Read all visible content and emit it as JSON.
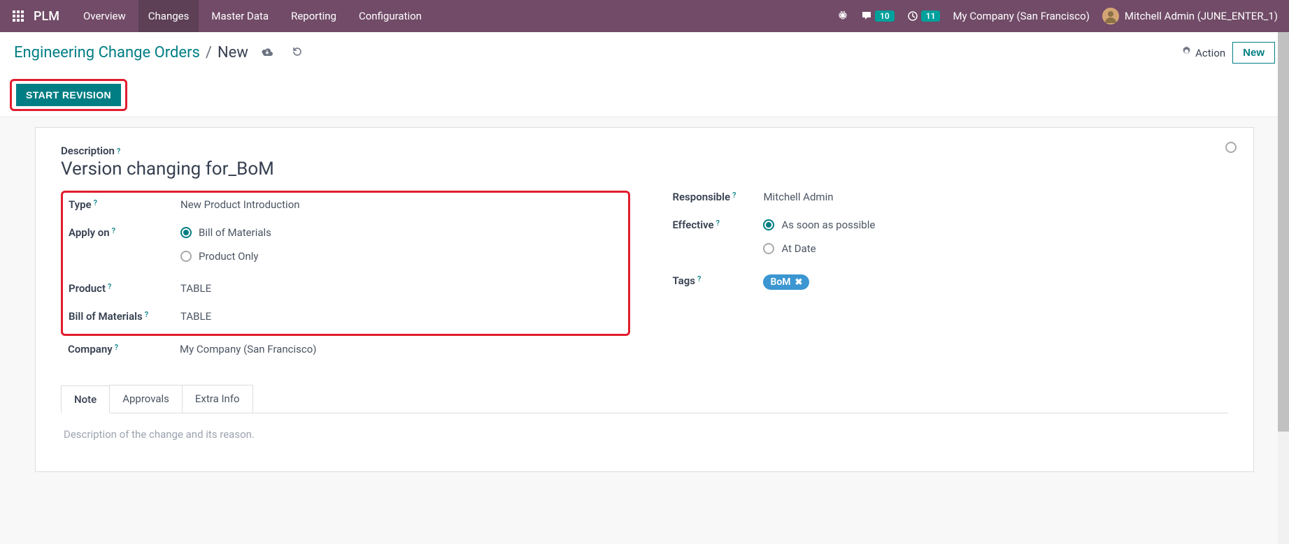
{
  "navbar": {
    "app_name": "PLM",
    "items": [
      "Overview",
      "Changes",
      "Master Data",
      "Reporting",
      "Configuration"
    ],
    "active_index": 1,
    "messages_count": "10",
    "activities_count": "11",
    "company": "My Company (San Francisco)",
    "user": "Mitchell Admin (JUNE_ENTER_1)"
  },
  "breadcrumb": {
    "root": "Engineering Change Orders",
    "current": "New",
    "action_label": "Action",
    "new_label": "New"
  },
  "status": {
    "start_revision": "START REVISION"
  },
  "form": {
    "description_label": "Description",
    "description_value": "Version changing for_BoM",
    "type_label": "Type",
    "type_value": "New Product Introduction",
    "apply_on_label": "Apply on",
    "apply_on_options": [
      "Bill of Materials",
      "Product Only"
    ],
    "apply_on_selected": 0,
    "product_label": "Product",
    "product_value": "TABLE",
    "bom_label": "Bill of Materials",
    "bom_value": "TABLE",
    "company_label": "Company",
    "company_value": "My Company (San Francisco)",
    "responsible_label": "Responsible",
    "responsible_value": "Mitchell Admin",
    "effective_label": "Effective",
    "effective_options": [
      "As soon as possible",
      "At Date"
    ],
    "effective_selected": 0,
    "tags_label": "Tags",
    "tags": [
      "BoM"
    ]
  },
  "tabs": {
    "items": [
      "Note",
      "Approvals",
      "Extra Info"
    ],
    "active_index": 0,
    "note_placeholder": "Description of the change and its reason."
  }
}
